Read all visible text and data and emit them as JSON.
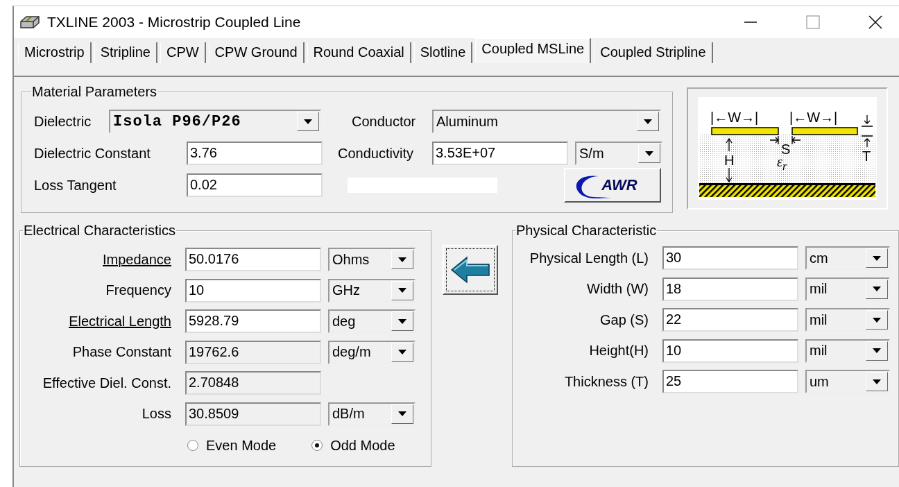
{
  "window": {
    "title": "TXLINE 2003 - Microstrip Coupled Line"
  },
  "tabs": [
    {
      "label": "Microstrip",
      "selected": false
    },
    {
      "label": "Stripline",
      "selected": false
    },
    {
      "label": "CPW",
      "selected": false
    },
    {
      "label": "CPW Ground",
      "selected": false
    },
    {
      "label": "Round Coaxial",
      "selected": false
    },
    {
      "label": "Slotline",
      "selected": false
    },
    {
      "label": "Coupled MSLine",
      "selected": true
    },
    {
      "label": "Coupled Stripline",
      "selected": false
    }
  ],
  "material": {
    "title": "Material Parameters",
    "dielectric": {
      "label": "Dielectric",
      "value": "Isola P96/P26"
    },
    "conductor": {
      "label": "Conductor",
      "value": "Aluminum"
    },
    "dielectric_constant": {
      "label": "Dielectric Constant",
      "value": "3.76"
    },
    "conductivity": {
      "label": "Conductivity",
      "value": "3.53E+07",
      "unit": "S/m"
    },
    "loss_tangent": {
      "label": "Loss Tangent",
      "value": "0.02"
    },
    "logo_button": "AWR"
  },
  "diagram": {
    "labels": {
      "width_left": "|←W→|",
      "width_right": "|←W→|",
      "gap": "S",
      "height": "H",
      "thickness": "T",
      "permittivity": "ε$_{r}$"
    }
  },
  "electrical": {
    "title": "Electrical Characteristics",
    "rows": [
      {
        "label": "Impedance",
        "underlined": true,
        "value": "50.0176",
        "editable": true,
        "unit": "Ohms"
      },
      {
        "label": "Frequency",
        "underlined": false,
        "value": "10",
        "editable": true,
        "unit": "GHz"
      },
      {
        "label": "Electrical Length",
        "underlined": true,
        "value": "5928.79",
        "editable": true,
        "unit": "deg"
      },
      {
        "label": "Phase Constant",
        "underlined": false,
        "value": "19762.6",
        "editable": false,
        "unit": "deg/m"
      },
      {
        "label": "Effective Diel. Const.",
        "underlined": false,
        "value": "2.70848",
        "editable": false
      },
      {
        "label": "Loss",
        "underlined": false,
        "value": "30.8509",
        "editable": false,
        "unit": "dB/m"
      }
    ],
    "modes": [
      {
        "label": "Even Mode",
        "selected": false
      },
      {
        "label": "Odd Mode",
        "selected": true
      }
    ]
  },
  "physical": {
    "title": "Physical Characteristic",
    "rows": [
      {
        "label": "Physical Length (L)",
        "value": "30",
        "unit": "cm"
      },
      {
        "label": "Width (W)",
        "value": "18",
        "unit": "mil"
      },
      {
        "label": "Gap (S)",
        "value": "22",
        "unit": "mil"
      },
      {
        "label": "Height(H)",
        "value": "10",
        "unit": "mil"
      },
      {
        "label": "Thickness (T)",
        "value": "25",
        "unit": "um"
      }
    ]
  }
}
